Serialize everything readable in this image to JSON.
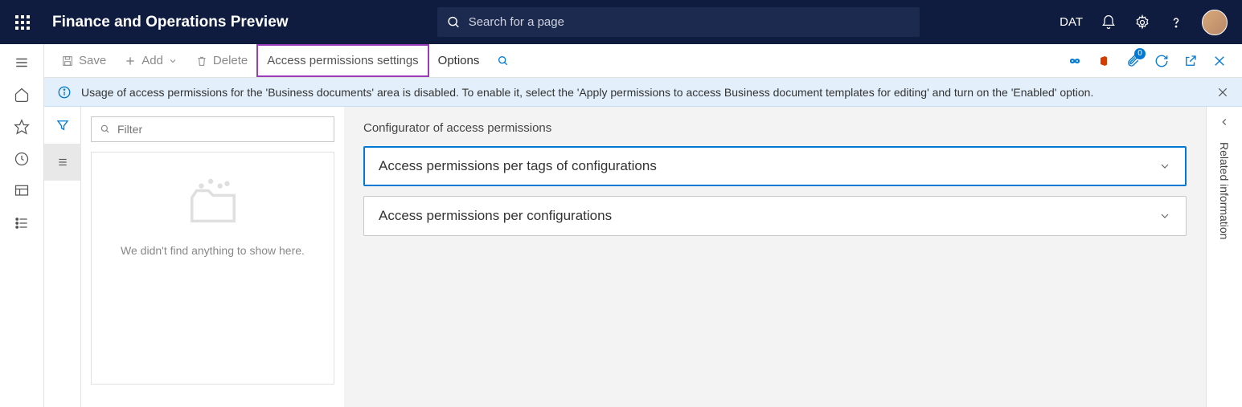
{
  "topnav": {
    "app_title": "Finance and Operations Preview",
    "search_placeholder": "Search for a page",
    "company": "DAT"
  },
  "cmdbar": {
    "save": "Save",
    "add": "Add",
    "delete": "Delete",
    "access_permissions": "Access permissions settings",
    "options": "Options",
    "attachment_badge": "0"
  },
  "infobar": {
    "message": "Usage of access permissions for the 'Business documents' area is disabled. To enable it, select the 'Apply permissions to access Business document templates for editing' and turn on the 'Enabled' option."
  },
  "list": {
    "filter_placeholder": "Filter",
    "empty_text": "We didn't find anything to show here."
  },
  "main": {
    "title": "Configurator of access permissions",
    "accordion1": "Access permissions per tags of configurations",
    "accordion2": "Access permissions per configurations"
  },
  "right": {
    "label": "Related information"
  }
}
